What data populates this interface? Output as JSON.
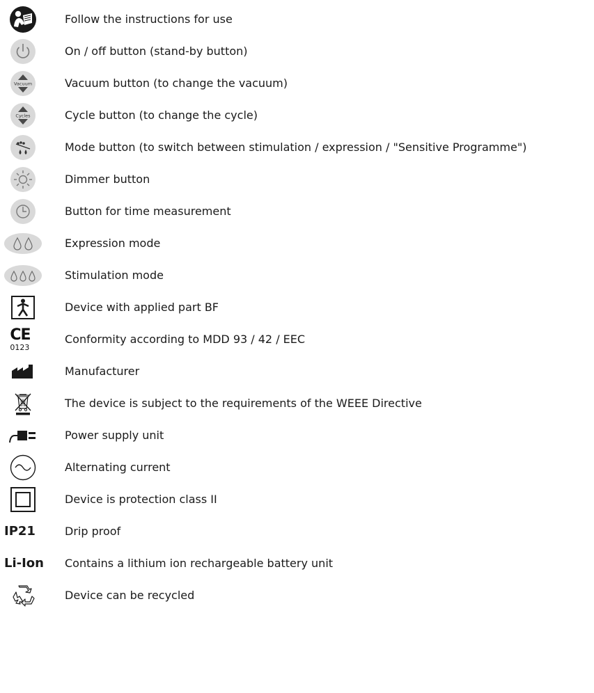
{
  "symbols": [
    {
      "icon": "manual-reader-icon",
      "text": "Follow the instructions for use"
    },
    {
      "icon": "power-icon",
      "text": "On / off button (stand-by button)"
    },
    {
      "icon": "vacuum-button-icon",
      "icon_label": "Vacuum",
      "text": "Vacuum button (to change the vacuum)"
    },
    {
      "icon": "cycle-button-icon",
      "icon_label": "Cycles",
      "text": "Cycle button (to change the cycle)"
    },
    {
      "icon": "mode-button-icon",
      "text": "Mode button (to switch between stimulation / expression / \"Sensitive Programme\")"
    },
    {
      "icon": "dimmer-icon",
      "text": "Dimmer button"
    },
    {
      "icon": "clock-icon",
      "text": "Button for time measurement"
    },
    {
      "icon": "two-drops-icon",
      "text": "Expression mode"
    },
    {
      "icon": "three-drops-icon",
      "text": "Stimulation mode"
    },
    {
      "icon": "bf-applied-part-icon",
      "text": "Device with applied part BF"
    },
    {
      "icon": "ce-mark-icon",
      "icon_label": "CE",
      "icon_number": "0123",
      "text": "Conformity according to MDD 93 / 42 / EEC"
    },
    {
      "icon": "manufacturer-icon",
      "text": "Manufacturer"
    },
    {
      "icon": "weee-bin-icon",
      "text": "The device is subject to the requirements of the WEEE Directive"
    },
    {
      "icon": "power-plug-icon",
      "text": "Power supply unit"
    },
    {
      "icon": "alternating-current-icon",
      "text": "Alternating current"
    },
    {
      "icon": "class-ii-icon",
      "text": "Device is protection class II"
    },
    {
      "icon": "ip21-text",
      "icon_label": "IP21",
      "text": "Drip proof"
    },
    {
      "icon": "li-ion-text",
      "icon_label": "Li-Ion",
      "text": "Contains a lithium ion rechargeable battery unit"
    },
    {
      "icon": "recycle-icon",
      "text": "Device can be recycled"
    }
  ],
  "colors": {
    "button_gray": "#d9d9d9",
    "icon_gray": "#7a7a7a",
    "icon_dark": "#1a1a1a"
  }
}
